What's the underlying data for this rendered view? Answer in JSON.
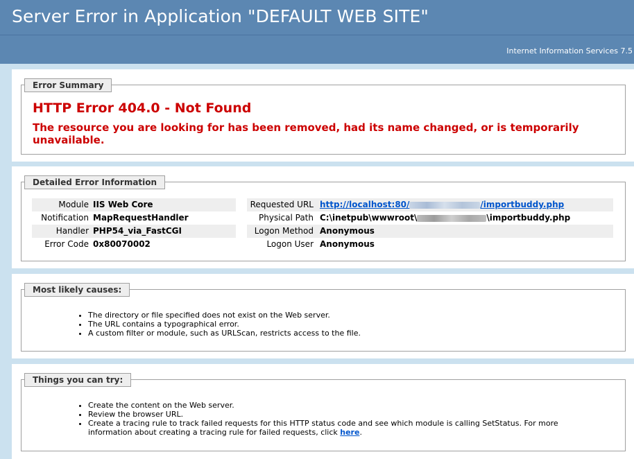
{
  "header": {
    "title": "Server Error in Application \"DEFAULT WEB SITE\"",
    "server": "Internet Information Services 7.5"
  },
  "summary": {
    "legend": "Error Summary",
    "title": "HTTP Error 404.0 - Not Found",
    "description": "The resource you are looking for has been removed, had its name changed, or is temporarily unavailable."
  },
  "details": {
    "legend": "Detailed Error Information",
    "left": [
      {
        "label": "Module",
        "value": "IIS Web Core"
      },
      {
        "label": "Notification",
        "value": "MapRequestHandler"
      },
      {
        "label": "Handler",
        "value": "PHP54_via_FastCGI"
      },
      {
        "label": "Error Code",
        "value": "0x80070002"
      }
    ],
    "right": [
      {
        "label": "Requested URL",
        "value_prefix": "http://localhost:80/",
        "value_suffix": "/importbuddy.php"
      },
      {
        "label": "Physical Path",
        "value_prefix": "C:\\inetpub\\wwwroot\\",
        "value_suffix": "\\importbuddy.php"
      },
      {
        "label": "Logon Method",
        "value": "Anonymous"
      },
      {
        "label": "Logon User",
        "value": "Anonymous"
      }
    ]
  },
  "causes": {
    "legend": "Most likely causes:",
    "items": [
      "The directory or file specified does not exist on the Web server.",
      "The URL contains a typographical error.",
      "A custom filter or module, such as URLScan, restricts access to the file."
    ]
  },
  "try": {
    "legend": "Things you can try:",
    "items": [
      "Create the content on the Web server.",
      "Review the browser URL."
    ],
    "last_item_text": "Create a tracing rule to track failed requests for this HTTP status code and see which module is calling SetStatus. For more information about creating a tracing rule for failed requests, click ",
    "link_text": "here",
    "last_item_end": "."
  },
  "colors": {
    "header_bg": "#5c87b2",
    "page_bg": "#cbe1ef",
    "error_red": "#cc0000",
    "link_blue": "#0055cc"
  }
}
